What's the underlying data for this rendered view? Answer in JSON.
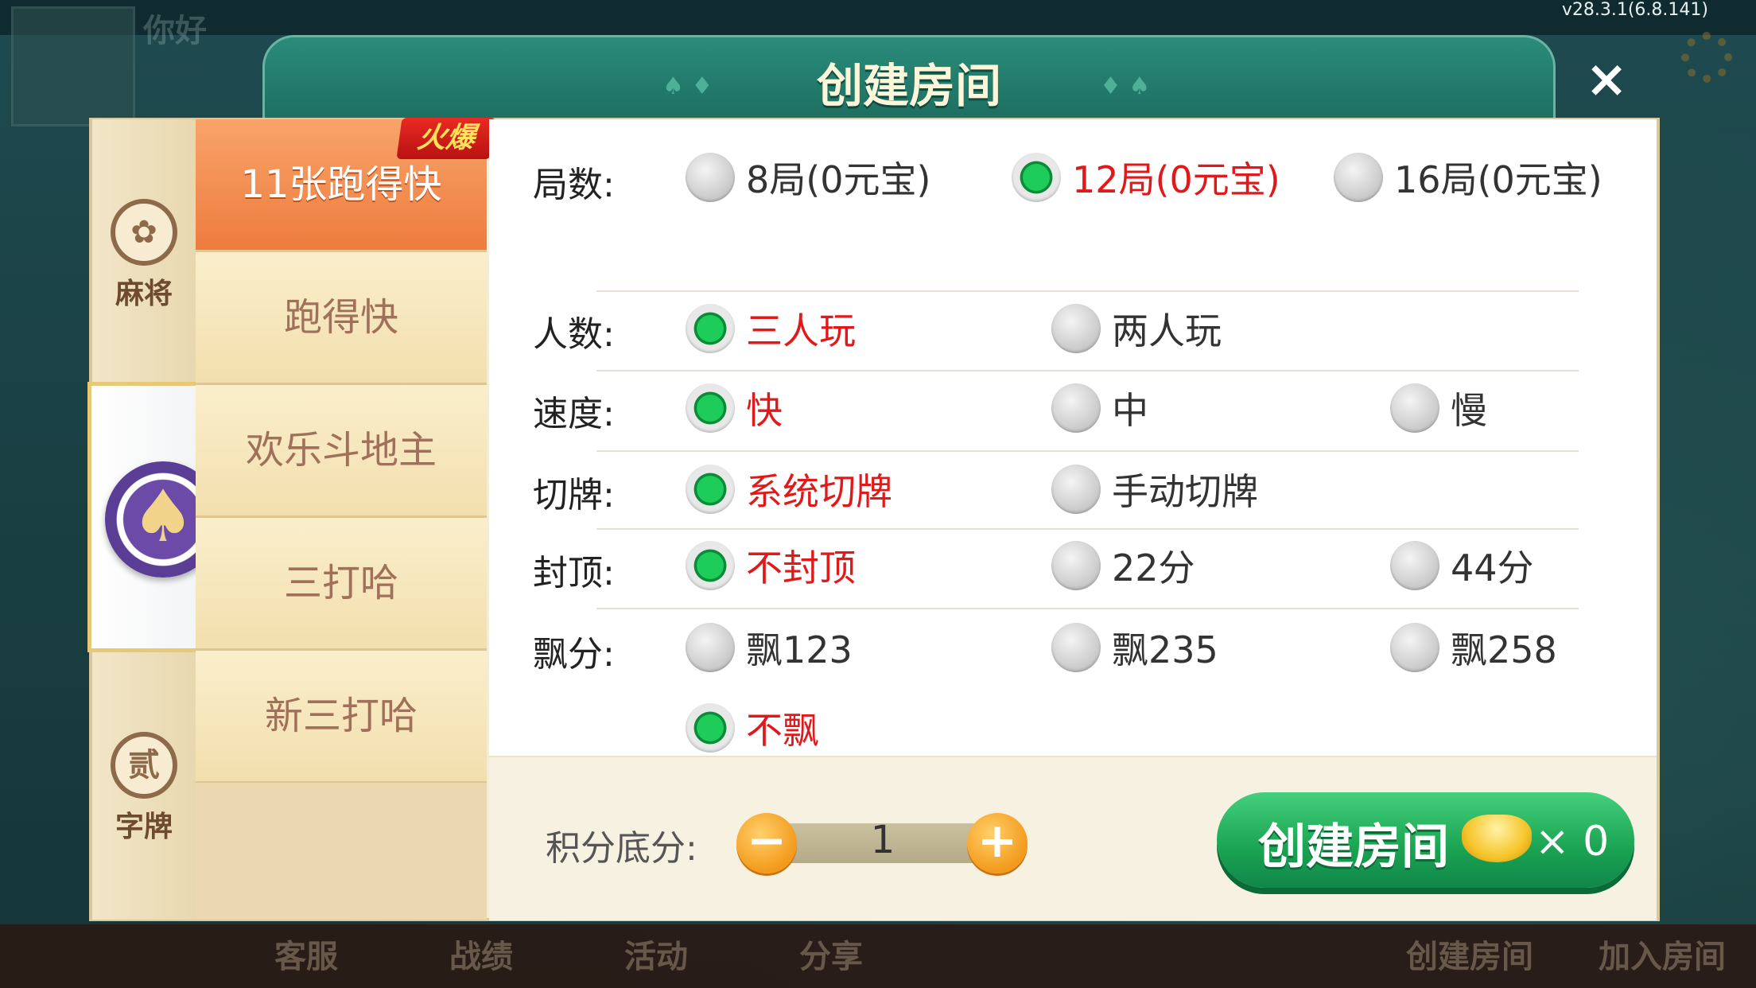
{
  "version": "v28.3.1(6.8.141)",
  "background": {
    "greeting": "你好",
    "bottom_items": [
      "客服",
      "战绩",
      "活动",
      "分享",
      "创建房间",
      "加入房间"
    ]
  },
  "dialog": {
    "title": "创建房间",
    "close_label": "×"
  },
  "categories": [
    {
      "label": "麻将",
      "icon": "mahjong-icon"
    },
    {
      "label": "",
      "icon": "spade-chip-icon",
      "selected": true
    },
    {
      "label": "字牌",
      "icon": "zipai-icon",
      "icon_char": "贰"
    }
  ],
  "games": [
    {
      "label": "11张跑得快",
      "active": true,
      "badge": "火爆"
    },
    {
      "label": "跑得快"
    },
    {
      "label": "欢乐斗地主"
    },
    {
      "label": "三打哈"
    },
    {
      "label": "新三打哈"
    }
  ],
  "options": {
    "rounds": {
      "label": "局数:",
      "choices": [
        "8局(0元宝)",
        "12局(0元宝)",
        "16局(0元宝)"
      ],
      "selected": 1
    },
    "players": {
      "label": "人数:",
      "choices": [
        "三人玩",
        "两人玩"
      ],
      "selected": 0
    },
    "speed": {
      "label": "速度:",
      "choices": [
        "快",
        "中",
        "慢"
      ],
      "selected": 0
    },
    "cut": {
      "label": "切牌:",
      "choices": [
        "系统切牌",
        "手动切牌"
      ],
      "selected": 0
    },
    "cap": {
      "label": "封顶:",
      "choices": [
        "不封顶",
        "22分",
        "44分"
      ],
      "selected": 0
    },
    "float": {
      "label": "飘分:",
      "choices": [
        "飘123",
        "飘235",
        "飘258",
        "不飘"
      ],
      "selected": 3
    }
  },
  "footer": {
    "score_label": "积分底分:",
    "score_value": "1",
    "minus": "−",
    "plus": "+",
    "create_label": "创建房间",
    "cost": "× 0"
  },
  "colors": {
    "header_green": "#1d6e60",
    "selected_text": "#e0191b",
    "radio_on": "#1ecc5a",
    "create_btn": "#1aa352",
    "active_tab": "#ee7c3e"
  }
}
